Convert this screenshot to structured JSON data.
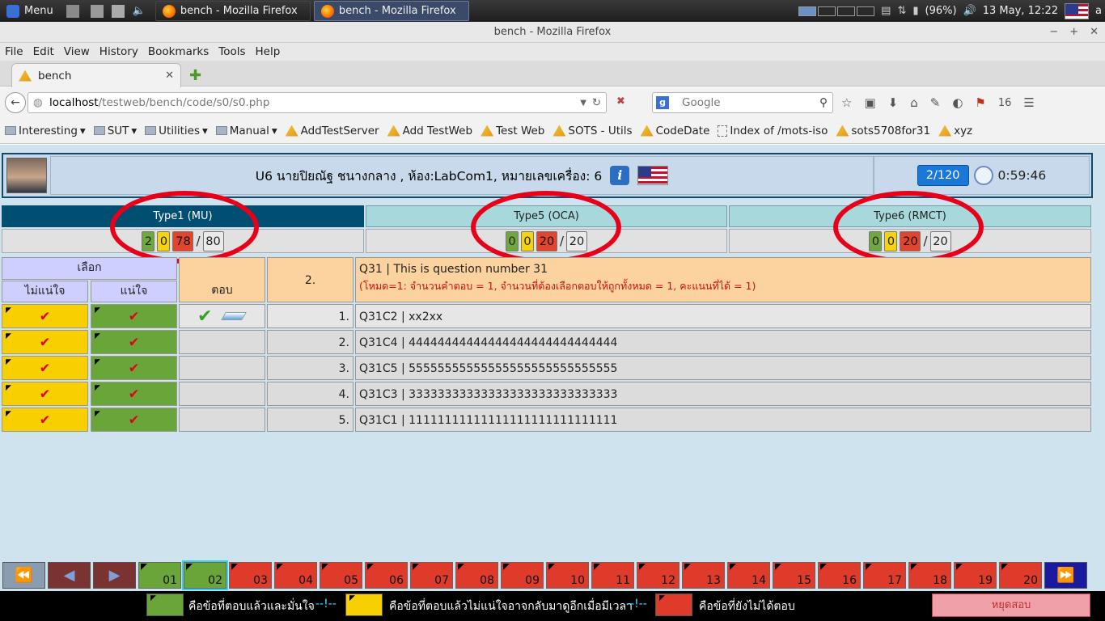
{
  "taskbar": {
    "menu_label": "Menu",
    "tasks": [
      "bench - Mozilla Firefox",
      "bench - Mozilla Firefox"
    ],
    "battery": "(96%)",
    "datetime": "13 May, 12:22",
    "extra": "a"
  },
  "window": {
    "title": "bench - Mozilla Firefox"
  },
  "menubar": [
    "File",
    "Edit",
    "View",
    "History",
    "Bookmarks",
    "Tools",
    "Help"
  ],
  "tab": {
    "label": "bench"
  },
  "url": {
    "host": "localhost",
    "path": "/testweb/bench/code/s0/s0.php"
  },
  "search": {
    "placeholder": "Google"
  },
  "nav": {
    "badge": "16"
  },
  "bookmarks": [
    "Interesting",
    "SUT",
    "Utilities",
    "Manual",
    "AddTestServer",
    "Add TestWeb",
    "Test Web",
    "SOTS - Utils",
    "CodeDate",
    "Index of /mots-iso",
    "sots5708for31",
    "xyz"
  ],
  "header": {
    "student": "U6 นายปิยณัฐ ชนางกลาง , ห้อง:LabCom1, หมายเลขเครื่อง: 6",
    "info": "i",
    "progress": "2/120",
    "time": "0:59:46"
  },
  "types": [
    {
      "name": "Type1 (MU)",
      "green": "2",
      "yellow": "0",
      "red": "78",
      "total": "80",
      "sep": "/"
    },
    {
      "name": "Type5 (OCA)",
      "green": "0",
      "yellow": "0",
      "red": "20",
      "total": "20",
      "sep": "/"
    },
    {
      "name": "Type6 (RMCT)",
      "green": "0",
      "yellow": "0",
      "red": "20",
      "total": "20",
      "sep": "/"
    }
  ],
  "question": {
    "select_label": "เลือก",
    "unsure_label": "ไม่แน่ใจ",
    "sure_label": "แน่ใจ",
    "answer_label": "ตอบ",
    "number": "2.",
    "title": "Q31 | This is question number 31",
    "mode": "(โหมด=1: จำนวนคำตอบ = 1, จำนวนที่ต้องเลือกตอบให้ถูกทั้งหมด = 1, คะแนนที่ได้ = 1)",
    "options": [
      {
        "num": "1.",
        "text": "Q31C2 | xx2xx"
      },
      {
        "num": "2.",
        "text": "Q31C4 | 44444444444444444444444444444"
      },
      {
        "num": "3.",
        "text": "Q31C5 | 55555555555555555555555555555"
      },
      {
        "num": "4.",
        "text": "Q31C3 | 33333333333333333333333333333"
      },
      {
        "num": "5.",
        "text": "Q31C1 | 11111111111111111111111111111"
      }
    ]
  },
  "pager": {
    "numbers": [
      "01",
      "02",
      "03",
      "04",
      "05",
      "06",
      "07",
      "08",
      "09",
      "10",
      "11",
      "12",
      "13",
      "14",
      "15",
      "16",
      "17",
      "18",
      "19",
      "20"
    ],
    "answered": 2,
    "current": "02"
  },
  "legend": {
    "sure": "คือข้อที่ตอบแล้วและมั่นใจ",
    "sep1": "--!--",
    "unsure": "คือข้อที่ตอบแล้วไม่แน่ใจอาจกลับมาดูอีกเมื่อมีเวลา",
    "sep2": "--!--",
    "unanswered": "คือข้อที่ยังไม่ได้ตอบ",
    "stop": "หยุดสอบ"
  },
  "colors": {
    "answered": "#6aa53a",
    "unsure": "#f8d002",
    "unanswered": "#e03a2b",
    "highlight_oval": "#e8001a"
  }
}
